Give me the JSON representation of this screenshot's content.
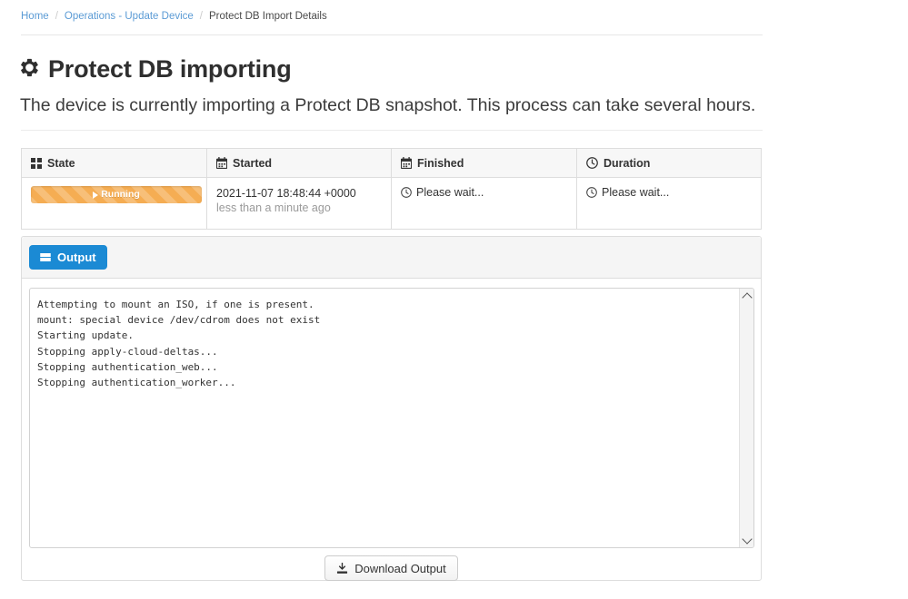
{
  "breadcrumb": {
    "items": [
      {
        "label": "Home",
        "current": false
      },
      {
        "label": "Operations - Update Device",
        "current": false
      },
      {
        "label": "Protect DB Import Details",
        "current": true
      }
    ],
    "separator": "/"
  },
  "header": {
    "icon": "gear-icon",
    "title": "Protect DB importing",
    "lead": "The device is currently importing a Protect DB snapshot. This process can take several hours."
  },
  "status_table": {
    "columns": [
      {
        "label": "State",
        "icon": "grid-icon"
      },
      {
        "label": "Started",
        "icon": "calendar-icon"
      },
      {
        "label": "Finished",
        "icon": "calendar-icon"
      },
      {
        "label": "Duration",
        "icon": "clock-icon"
      }
    ],
    "row": {
      "state": {
        "label": "Running",
        "icon": "play-icon",
        "progress_percent": 100,
        "color": "#f5ad53"
      },
      "started": {
        "timestamp": "2021-11-07 18:48:44 +0000",
        "relative": "less than a minute ago"
      },
      "finished": {
        "icon": "clock-icon",
        "text": "Please wait..."
      },
      "duration": {
        "icon": "clock-icon",
        "text": "Please wait..."
      }
    }
  },
  "output_panel": {
    "button": {
      "label": "Output",
      "icon": "list-icon",
      "color": "#1b8ad4"
    },
    "log": "Attempting to mount an ISO, if one is present.\nmount: special device /dev/cdrom does not exist\nStarting update.\nStopping apply-cloud-deltas...\nStopping authentication_web...\nStopping authentication_worker...",
    "download_button": {
      "label": "Download Output",
      "icon": "download-icon"
    }
  }
}
